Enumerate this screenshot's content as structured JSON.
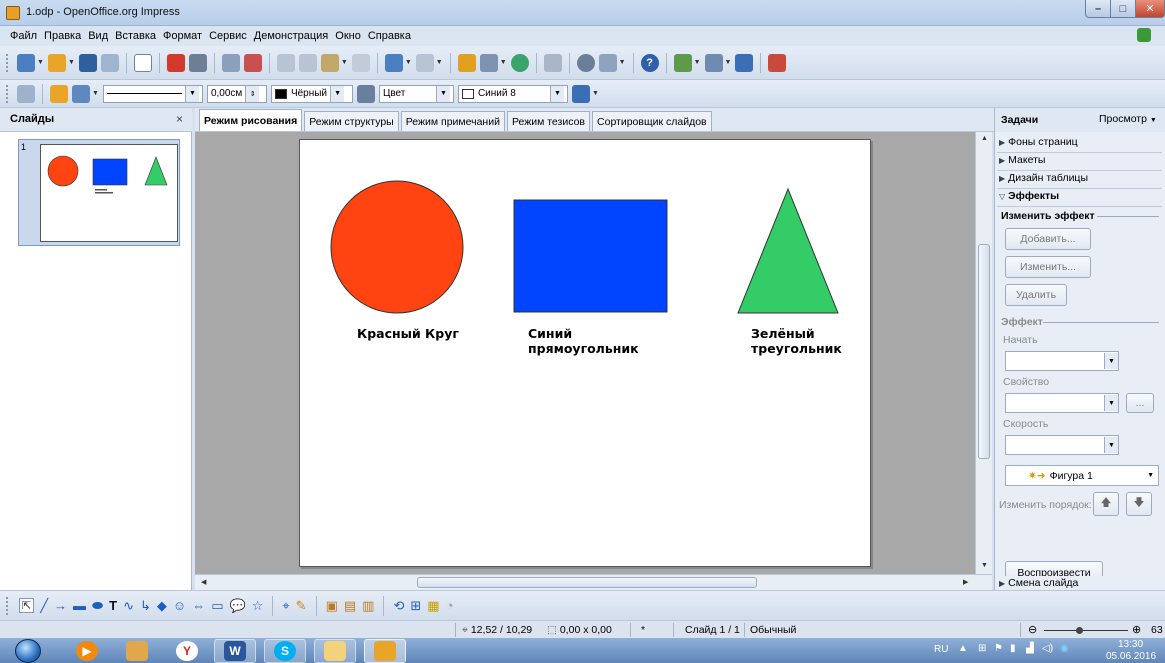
{
  "window": {
    "title": "1.odp - OpenOffice.org Impress",
    "min_glyph": "–",
    "max_glyph": "□",
    "close_glyph": "✕"
  },
  "menu": [
    "Файл",
    "Правка",
    "Вид",
    "Вставка",
    "Формат",
    "Сервис",
    "Демонстрация",
    "Окно",
    "Справка"
  ],
  "toolbar2": {
    "line_width": "0,00см",
    "line_color": "Чёрный",
    "area_style": "Цвет",
    "area_color": "Синий 8"
  },
  "slides_pane": {
    "title": "Слайды",
    "close_glyph": "×",
    "thumbnail_number": "1"
  },
  "view_tabs": [
    "Режим рисования",
    "Режим структуры",
    "Режим примечаний",
    "Режим тезисов",
    "Сортировщик слайдов"
  ],
  "slide": {
    "circle_label": "Красный Круг",
    "rect_label_1": "Синий",
    "rect_label_2": "прямоугольник",
    "triangle_label_1": "Зелёный",
    "triangle_label_2": "треугольник",
    "circle_color": "#ff4411",
    "rect_color": "#0044ff",
    "triangle_color": "#33cc66"
  },
  "tasks_pane": {
    "title": "Задачи",
    "view_menu": "Просмотр",
    "sections": [
      "Фоны страниц",
      "Макеты",
      "Дизайн таблицы",
      "Эффекты"
    ],
    "change_effect": "Изменить эффект",
    "add_button": "Добавить...",
    "edit_button": "Изменить...",
    "delete_button": "Удалить",
    "effect_group": "Эффект",
    "start_label": "Начать",
    "property_label": "Свойство",
    "speed_label": "Скорость",
    "effect_item": "Фигура 1",
    "reorder_label": "Изменить порядок:",
    "play_button": "Воспроизвести",
    "slide_transition": "Смена слайда"
  },
  "statusbar": {
    "position": "12,52 / 10,29",
    "size": "0,00 x 0,00",
    "modified": "*",
    "slide": "Слайд 1 / 1",
    "layout": "Обычный",
    "zoom": "63"
  },
  "taskbar": {
    "lang": "RU",
    "time": "13:30",
    "date": "05.06.2016"
  }
}
